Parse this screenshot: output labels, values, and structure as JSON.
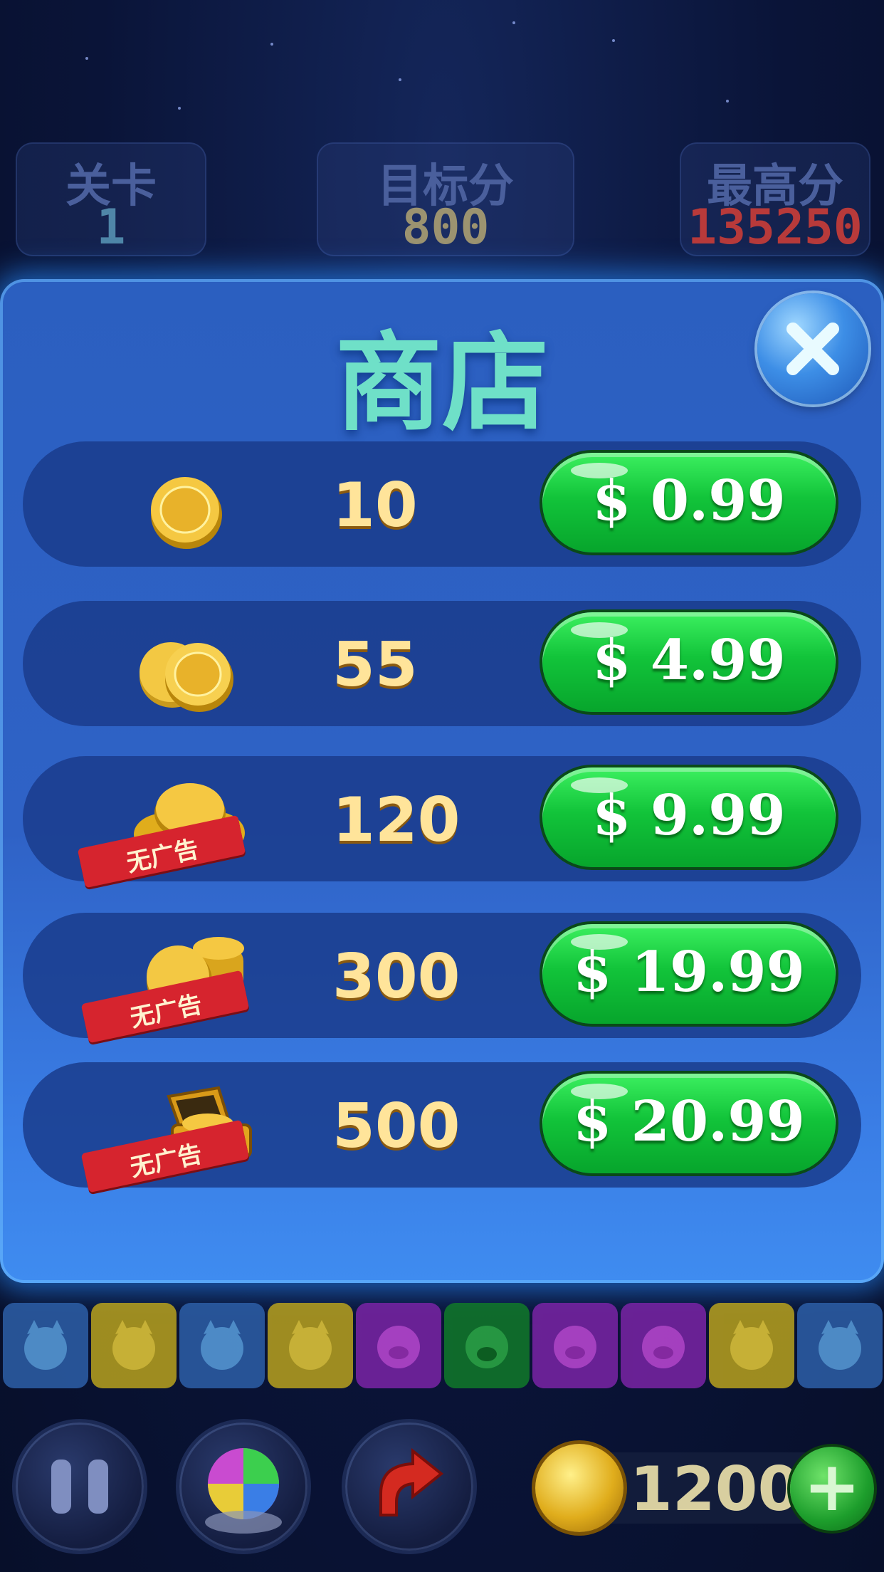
{
  "hud": {
    "level": {
      "label": "关卡",
      "value": "1"
    },
    "target": {
      "label": "目标分",
      "value": "800"
    },
    "best": {
      "label": "最高分",
      "value": "135250"
    }
  },
  "shop": {
    "title": "商店",
    "close_icon": "close-icon",
    "ribbon_text": "无广告",
    "items": [
      {
        "amount": "10",
        "price": "$ 0.99",
        "icon": "single-coin-icon",
        "no_ads": false
      },
      {
        "amount": "55",
        "price": "$ 4.99",
        "icon": "two-coins-icon",
        "no_ads": false
      },
      {
        "amount": "120",
        "price": "$ 9.99",
        "icon": "coin-pile-icon",
        "no_ads": true
      },
      {
        "amount": "300",
        "price": "$ 19.99",
        "icon": "coin-stack-icon",
        "no_ads": true
      },
      {
        "amount": "500",
        "price": "$ 20.99",
        "icon": "treasure-chest-icon",
        "no_ads": true
      }
    ]
  },
  "tiles": [
    "blue-cat",
    "yellow-cat",
    "blue-cat",
    "yellow-cat",
    "purple-pig",
    "green-dog",
    "purple-pig",
    "purple-pig",
    "yellow-cat",
    "blue-cat"
  ],
  "bottom_bar": {
    "coins": "12000",
    "plus": "+",
    "buttons": [
      "pause-icon",
      "rainbow-ball-icon",
      "undo-arrow-icon"
    ]
  },
  "colors": {
    "accent_title": "#6fe0c8",
    "price_green": "#12c43a",
    "best_score": "#b83a3a"
  }
}
